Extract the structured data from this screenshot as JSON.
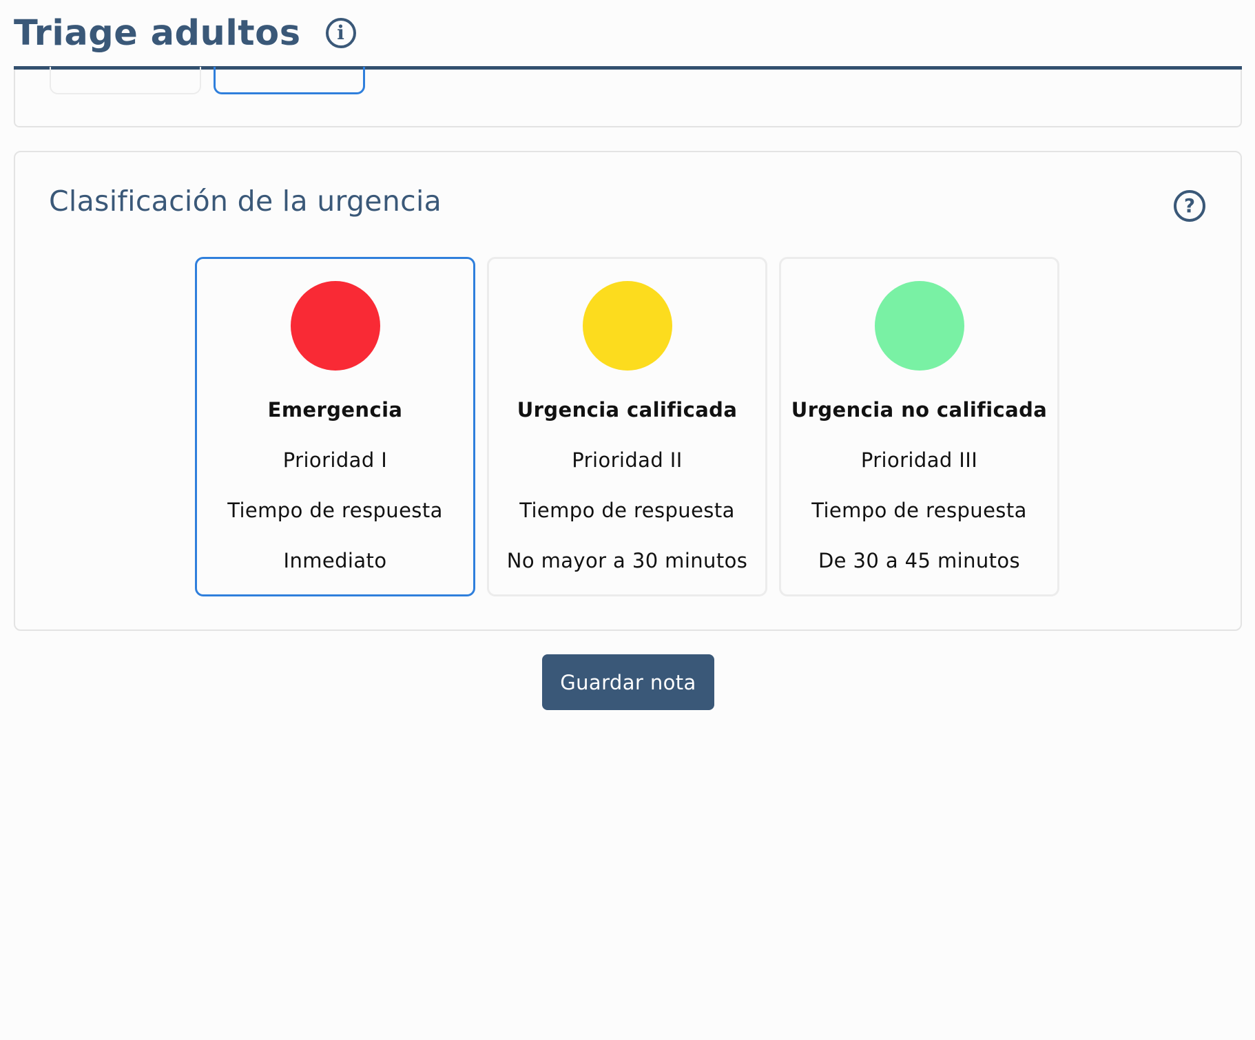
{
  "header": {
    "title": "Triage adultos",
    "info_icon": "info-icon"
  },
  "classification": {
    "title": "Clasificación de la urgencia",
    "help_icon": "question-circle-icon",
    "cards": [
      {
        "title": "Emergencia",
        "priority": "Prioridad I",
        "response_label": "Tiempo de respuesta",
        "response_value": "Inmediato",
        "color": "#f92a35",
        "selected": true
      },
      {
        "title": "Urgencia calificada",
        "priority": "Prioridad II",
        "response_label": "Tiempo de respuesta",
        "response_value": "No mayor a 30 minutos",
        "color": "#fcdc1e",
        "selected": false
      },
      {
        "title": "Urgencia no calificada",
        "priority": "Prioridad III",
        "response_label": "Tiempo de respuesta",
        "response_value": "De 30 a 45 minutos",
        "color": "#79f1a4",
        "selected": false
      }
    ]
  },
  "actions": {
    "save_label": "Guardar nota"
  },
  "colors": {
    "accent": "#3a5878",
    "selection": "#2f7fdc"
  }
}
